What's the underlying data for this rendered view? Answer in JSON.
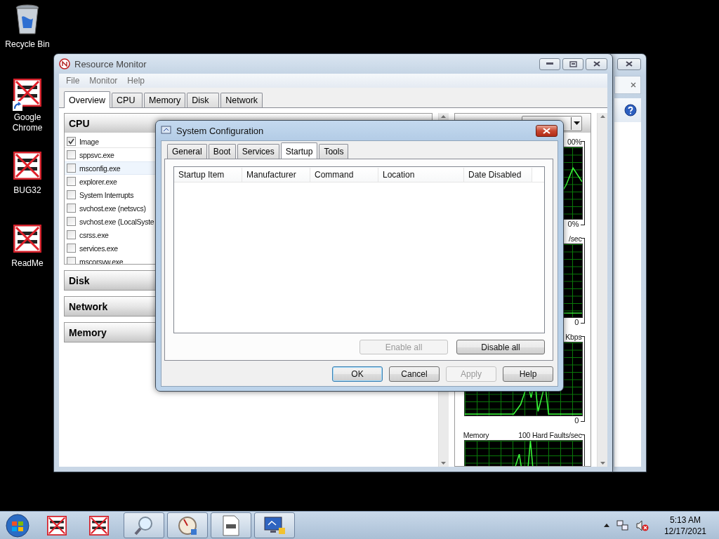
{
  "desktop_icons": [
    {
      "label": "Recycle Bin",
      "kind": "bin",
      "shortcut": false
    },
    {
      "label": "Google Chrome",
      "kind": "denied",
      "shortcut": true
    },
    {
      "label": "BUG32",
      "kind": "denied",
      "shortcut": false
    },
    {
      "label": "ReadMe",
      "kind": "denied",
      "shortcut": false
    }
  ],
  "resource_monitor": {
    "title": "Resource Monitor",
    "menu": [
      "File",
      "Monitor",
      "Help"
    ],
    "tabs": [
      {
        "label": "Overview",
        "selected": true
      },
      {
        "label": "CPU",
        "selected": false
      },
      {
        "label": "Memory",
        "selected": false
      },
      {
        "label": "Disk",
        "selected": false
      },
      {
        "label": "Network",
        "selected": false
      }
    ],
    "cpu": {
      "title": "CPU",
      "column": {
        "label": "Image",
        "checked": true
      },
      "processes": [
        {
          "name": "sppsvc.exe",
          "checked": false,
          "selected": false
        },
        {
          "name": "msconfig.exe",
          "checked": false,
          "selected": true
        },
        {
          "name": "explorer.exe",
          "checked": false,
          "selected": false
        },
        {
          "name": "System Interrupts",
          "checked": false,
          "selected": false
        },
        {
          "name": "svchost.exe (netsvcs)",
          "checked": false,
          "selected": false
        },
        {
          "name": "svchost.exe (LocalSyste",
          "checked": false,
          "selected": false
        },
        {
          "name": "csrss.exe",
          "checked": false,
          "selected": false
        },
        {
          "name": "services.exe",
          "checked": false,
          "selected": false
        },
        {
          "name": "mscorsvw.exe",
          "checked": false,
          "selected": false
        }
      ]
    },
    "sections": [
      "Disk",
      "Network",
      "Memory"
    ],
    "graphs": [
      {
        "scale": "00%",
        "floor": "0%"
      },
      {
        "scale": "/sec",
        "floor": "0"
      },
      {
        "scale": "Kbps",
        "floor": "0"
      },
      {
        "name": "Memory",
        "scale": "100 Hard Faults/sec"
      }
    ]
  },
  "system_configuration": {
    "title": "System Configuration",
    "tabs": [
      {
        "label": "General",
        "selected": false
      },
      {
        "label": "Boot",
        "selected": false
      },
      {
        "label": "Services",
        "selected": false
      },
      {
        "label": "Startup",
        "selected": true
      },
      {
        "label": "Tools",
        "selected": false
      }
    ],
    "columns": [
      "Startup Item",
      "Manufacturer",
      "Command",
      "Location",
      "Date Disabled"
    ],
    "list_buttons": [
      {
        "label": "Enable all",
        "disabled": true
      },
      {
        "label": "Disable all",
        "disabled": false
      }
    ],
    "buttons": [
      {
        "label": "OK",
        "disabled": false,
        "default": true
      },
      {
        "label": "Cancel",
        "disabled": false,
        "default": false
      },
      {
        "label": "Apply",
        "disabled": true,
        "default": false
      },
      {
        "label": "Help",
        "disabled": false,
        "default": false
      }
    ]
  },
  "taskbar": {
    "pinned": [
      {
        "kind": "denied",
        "running": false
      },
      {
        "kind": "denied",
        "running": false
      },
      {
        "kind": "search",
        "running": true
      },
      {
        "kind": "gauge",
        "running": true
      },
      {
        "kind": "document",
        "running": true
      },
      {
        "kind": "monitor",
        "running": true
      }
    ],
    "time": "5:13 AM",
    "date": "12/17/2021"
  }
}
